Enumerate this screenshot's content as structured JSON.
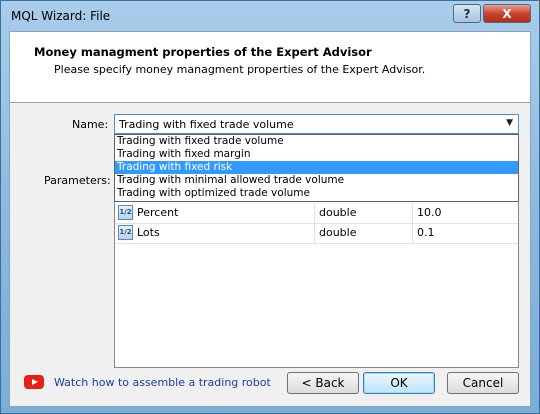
{
  "window": {
    "title": "MQL Wizard: File",
    "help_label": "?",
    "close_label": "X"
  },
  "header": {
    "title": "Money managment properties of the Expert Advisor",
    "subtitle": "Please specify money managment properties of the Expert Advisor."
  },
  "form": {
    "name_label": "Name:",
    "parameters_label": "Parameters:",
    "name_value": "Trading with fixed trade volume",
    "dropdown_options": [
      {
        "label": "Trading with fixed trade volume",
        "selected": false
      },
      {
        "label": "Trading with fixed margin",
        "selected": false
      },
      {
        "label": "Trading with fixed risk",
        "selected": true
      },
      {
        "label": "Trading with minimal allowed trade volume",
        "selected": false
      },
      {
        "label": "Trading with optimized trade volume",
        "selected": false
      }
    ]
  },
  "parameters": [
    {
      "name": "Percent",
      "type": "double",
      "value": "10.0",
      "icon": "parameter-icon"
    },
    {
      "name": "Lots",
      "type": "double",
      "value": "0.1",
      "icon": "parameter-icon"
    }
  ],
  "footer": {
    "link_text": "Watch how to assemble a trading robot",
    "back_label": "< Back",
    "ok_label": "OK",
    "cancel_label": "Cancel"
  },
  "colors": {
    "selection": "#3399ff",
    "link": "#1a3e9c",
    "youtube": "#e62117"
  }
}
